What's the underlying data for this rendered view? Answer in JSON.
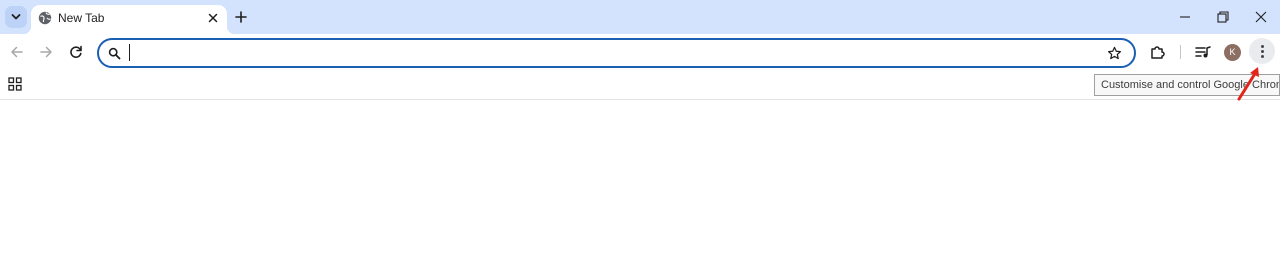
{
  "tabs": [
    {
      "title": "New Tab",
      "favicon": "globe-icon",
      "active": true
    }
  ],
  "omnibox": {
    "value": "",
    "placeholder": ""
  },
  "profile": {
    "initial": "K",
    "color": "#8d6e63"
  },
  "tooltip": {
    "text": "Customise and control Google Chrome"
  },
  "colors": {
    "tabstrip": "#d3e3fd",
    "omnibox_border": "#1a5fb4",
    "annotation_arrow": "#e3241b"
  },
  "icons": {
    "tab_search": "chevron-down-icon",
    "new_tab": "plus-icon",
    "window": [
      "minimize-icon",
      "restore-icon",
      "close-icon"
    ],
    "nav": [
      "back-arrow-icon",
      "forward-arrow-icon",
      "reload-icon"
    ],
    "toolbar": [
      "extensions-puzzle-icon",
      "media-queue-icon",
      "kebab-menu-icon"
    ],
    "bookmark": "star-icon",
    "apps": "apps-grid-icon"
  }
}
